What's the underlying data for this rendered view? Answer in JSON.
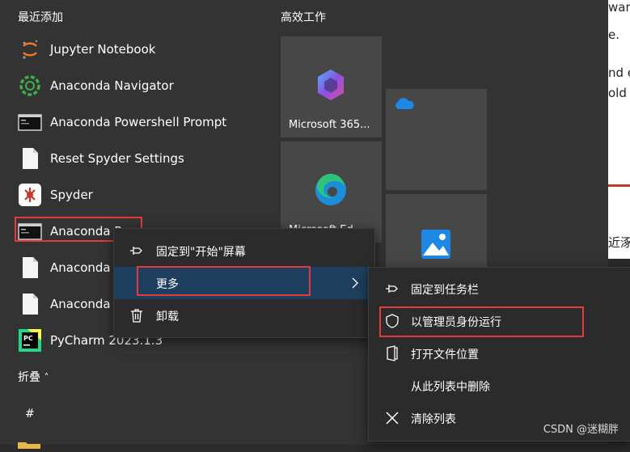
{
  "sections": {
    "recent": "最近添加",
    "productivity": "高效工作",
    "collapse": "折叠",
    "hash": "#"
  },
  "apps": [
    {
      "label": "Jupyter Notebook",
      "icon": "jupyter-icon"
    },
    {
      "label": "Anaconda Navigator",
      "icon": "anaconda-navigator-icon"
    },
    {
      "label": "Anaconda Powershell Prompt",
      "icon": "terminal-icon"
    },
    {
      "label": "Reset Spyder Settings",
      "icon": "document-icon"
    },
    {
      "label": "Spyder",
      "icon": "spyder-icon"
    },
    {
      "label": "Anaconda P",
      "icon": "terminal-icon"
    },
    {
      "label": "Anaconda",
      "icon": "document-icon"
    },
    {
      "label": "Anaconda",
      "icon": "document-icon"
    },
    {
      "label": "PyCharm 2023.1.3",
      "icon": "pycharm-icon"
    }
  ],
  "tiles": [
    {
      "label": "Microsoft 365...",
      "icon": "microsoft-365-icon"
    },
    {
      "label": "Microsoft Ed",
      "icon": "edge-icon"
    },
    {
      "label": "",
      "icon": "onedrive-icon"
    },
    {
      "label": "",
      "icon": "photos-icon"
    }
  ],
  "context_menu": {
    "items": [
      {
        "label": "固定到\"开始\"屏幕",
        "icon": "pin-icon"
      },
      {
        "label": "更多",
        "icon": "chevron-right-icon"
      },
      {
        "label": "卸载",
        "icon": "trash-icon"
      }
    ]
  },
  "submenu": {
    "items": [
      {
        "label": "固定到任务栏",
        "icon": "pin-icon"
      },
      {
        "label": "以管理员身份运行",
        "icon": "shield-icon"
      },
      {
        "label": "打开文件位置",
        "icon": "folder-open-icon"
      },
      {
        "label": "从此列表中删除",
        "icon": ""
      },
      {
        "label": "清除列表",
        "icon": "close-icon"
      }
    ]
  },
  "background_window": {
    "fragments": [
      "wan",
      "e.",
      "nd e",
      "old A",
      "近涿"
    ]
  },
  "watermark": "CSDN @迷糊胖",
  "colors": {
    "highlight": "#e23b3b",
    "hover": "#1f3f5e",
    "menu_bg": "#2b2b2b"
  }
}
